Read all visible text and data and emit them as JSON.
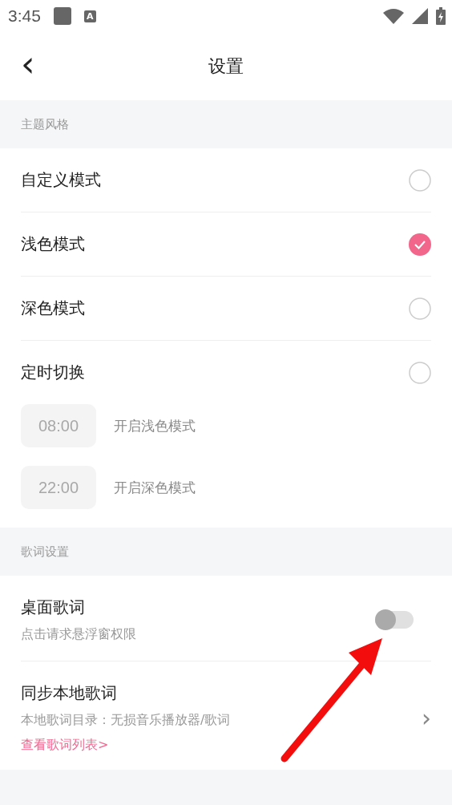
{
  "status_bar": {
    "time": "3:45",
    "notification_badge": "A"
  },
  "header": {
    "back": "‹",
    "title": "设置"
  },
  "theme_section": {
    "title": "主题风格",
    "options": [
      {
        "label": "自定义模式",
        "selected": false
      },
      {
        "label": "浅色模式",
        "selected": true
      },
      {
        "label": "深色模式",
        "selected": false
      },
      {
        "label": "定时切换",
        "selected": false
      }
    ],
    "schedule": [
      {
        "time": "08:00",
        "label": "开启浅色模式"
      },
      {
        "time": "22:00",
        "label": "开启深色模式"
      }
    ]
  },
  "lyrics_section": {
    "title": "歌词设置",
    "items": [
      {
        "kind": "toggle",
        "title": "桌面歌词",
        "subtitle": "点击请求悬浮窗权限",
        "on": false
      },
      {
        "kind": "link",
        "title": "同步本地歌词",
        "subtitle": "本地歌词目录：无损音乐播放器/歌词",
        "link": "查看歌词列表>",
        "chevron": "›"
      }
    ]
  }
}
